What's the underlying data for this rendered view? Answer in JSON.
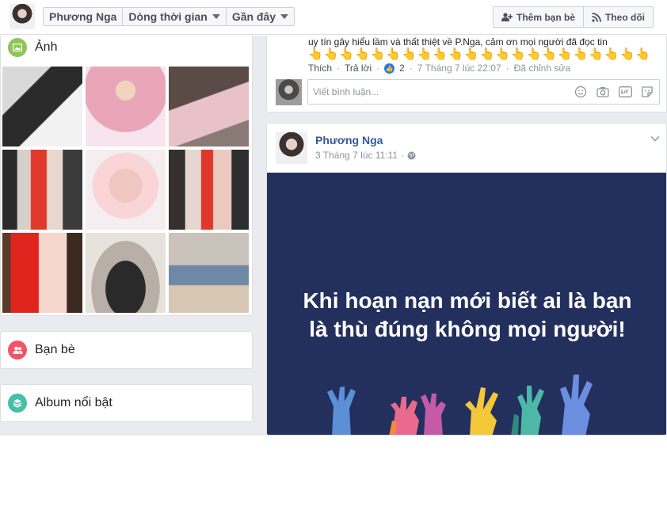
{
  "header": {
    "profile_name": "Phương Nga",
    "timeline_label": "Dòng thời gian",
    "recent_label": "Gần đây",
    "add_friend_label": "Thêm bạn bè",
    "follow_label": "Theo dõi"
  },
  "left": {
    "photos_title": "Ảnh",
    "friends_title": "Bạn bè",
    "albums_title": "Album nổi bật"
  },
  "comment": {
    "text": "uy tín gây hiểu lầm và thất thiệt về P.Nga, cảm ơn mọi người đã đọc tin",
    "emojis": "👆👆👆👆👆👆👆👆👆👆👆👆👆👆👆👆👆👆👆👆👆👆",
    "like_label": "Thích",
    "reply_label": "Trả lời",
    "like_count": "2",
    "timestamp": "7 Tháng 7 lúc 22:07",
    "edited_label": "Đã chỉnh sửa",
    "sep": "·",
    "input_placeholder": "Viết bình luận..."
  },
  "post": {
    "author": "Phương Nga",
    "time": "3 Tháng 7 lúc 11:11",
    "sep": "·",
    "quote_line1": "Khi hoạn nạn mới biết ai là bạn",
    "quote_line2": "là thù đúng không mọi người!"
  },
  "colors": {
    "link_blue": "#365899",
    "post_bg": "#23305d",
    "photos_icon": "#8fc556",
    "friends_icon": "#f35369",
    "albums_icon": "#45bfa8"
  }
}
